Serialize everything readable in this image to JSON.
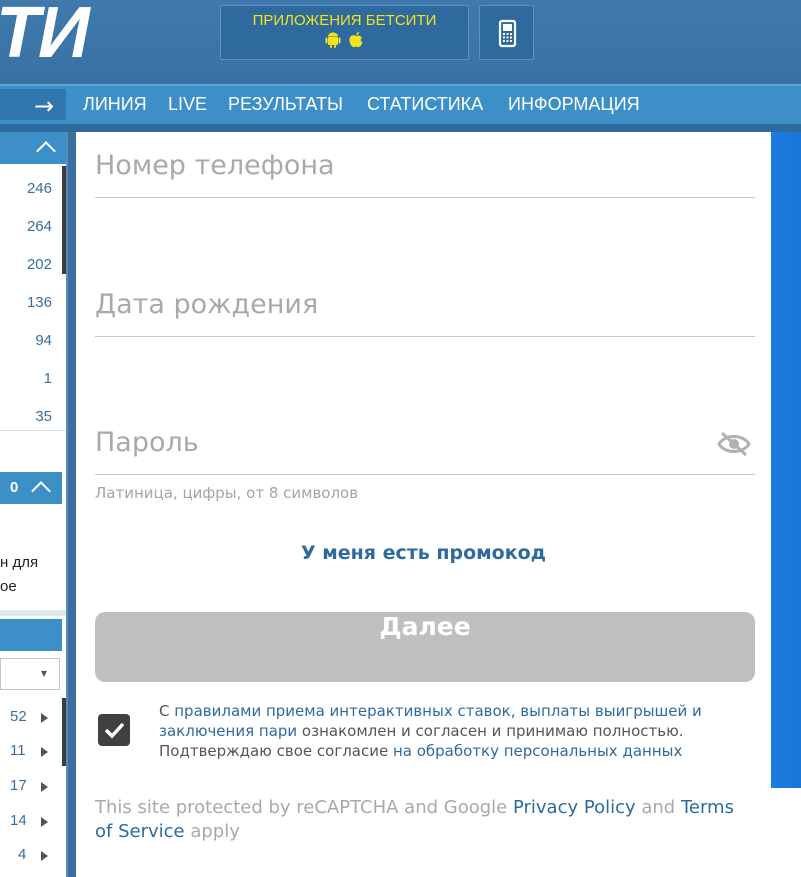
{
  "header": {
    "logo_text": "ТИ",
    "apps_button_label": "ПРИЛОЖЕНИЯ БЕТСИТИ",
    "apps_icons": [
      "android-icon",
      "apple-icon"
    ],
    "phone_icon": "mobile-phone-icon"
  },
  "nav": {
    "items": [
      "ЛИНИЯ",
      "LIVE",
      "РЕЗУЛЬТАТЫ",
      "СТАТИСТИКА",
      "ИНФОРМАЦИЯ"
    ]
  },
  "sidebar": {
    "top_counts": [
      "246",
      "264",
      "202",
      "136",
      "94",
      "1",
      "35"
    ],
    "section_count": "0",
    "text_line1": "н для",
    "text_line2": "ое",
    "bottom_counts": [
      "52",
      "11",
      "17",
      "14",
      "4"
    ]
  },
  "form": {
    "phone_placeholder": "Номер телефона",
    "birthdate_placeholder": "Дата рождения",
    "password_placeholder": "Пароль",
    "password_hint": "Латиница, цифры, от 8 символов",
    "promo_link": "У меня есть промокод",
    "next_button": "Далее",
    "consent": {
      "prefix": "С ",
      "link1": "правилами приема интерактивных ставок, выплаты выигрышей и заключения пари",
      "middle": " ознакомлен и согласен и принимаю полностью. Подтверждаю свое согласие ",
      "link2": "на обработку персональных данных",
      "checked": true
    },
    "captcha": {
      "prefix": "This site protected by reCAPTCHA and Google ",
      "privacy": "Privacy Policy",
      "and": " and ",
      "terms": "Terms of Service",
      "suffix": " apply"
    }
  },
  "colors": {
    "header_bg": "#3a71a3",
    "nav_bg": "#3d8fc7",
    "apps_text": "#f4e21c",
    "link": "#2f6a9e",
    "button_disabled": "#bfbfbf"
  }
}
